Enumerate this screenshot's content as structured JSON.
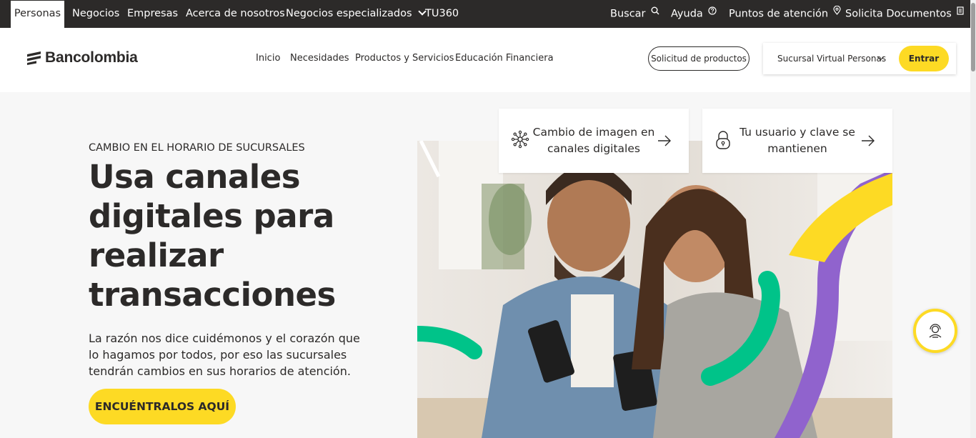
{
  "topbar": {
    "segments": [
      "Personas",
      "Negocios",
      "Empresas",
      "Acerca de nosotros",
      "Negocios especializados",
      "TU360"
    ],
    "right": {
      "search": "Buscar",
      "help": "Ayuda",
      "points": "Puntos de atención",
      "docs": "Solicita Documentos"
    }
  },
  "header": {
    "logo_text": "Bancolombia",
    "nav": [
      "Inicio",
      "Necesidades",
      "Productos y Servicios",
      "Educación Financiera"
    ],
    "request_button": "Solicitud de productos",
    "branch_select": "Sucursal Virtual Personas",
    "enter_button": "Entrar"
  },
  "hero": {
    "kicker": "CAMBIO EN EL HORARIO DE SUCURSALES",
    "title": "Usa canales digitales para realizar transacciones",
    "description": "La razón nos dice cuidémonos y el corazón que lo hagamos por todos, por eso las sucursales tendrán cambios en sus horarios de atención.",
    "cta": "ENCUÉNTRALOS AQUÍ"
  },
  "cards": [
    {
      "label": "Cambio de imagen en canales digitales",
      "icon": "network-icon"
    },
    {
      "label": "Tu usuario y clave se mantienen",
      "icon": "lock-icon"
    }
  ],
  "colors": {
    "brand_yellow": "#fdda24",
    "dark": "#2c2a29",
    "accent_purple": "#9063cd",
    "accent_green": "#00c389"
  }
}
